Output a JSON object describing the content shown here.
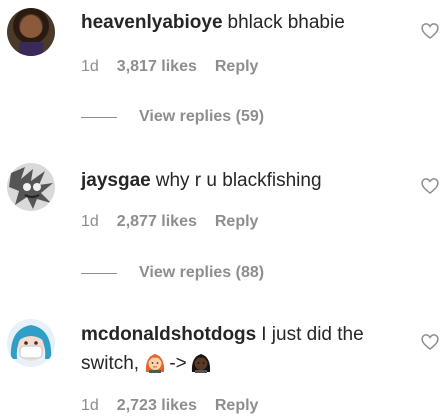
{
  "comments": [
    {
      "username": "heavenlyabioye",
      "text": "bhlack bhabie",
      "time": "1d",
      "likes": "3,817 likes",
      "reply_label": "Reply",
      "view_replies": "View replies (59)"
    },
    {
      "username": "jaysgae",
      "text": "why r u blackfishing",
      "time": "1d",
      "likes": "2,877 likes",
      "reply_label": "Reply",
      "view_replies": "View replies (88)"
    },
    {
      "username": "mcdonaldshotdogs",
      "text_line1": "I just did the",
      "text_line2_prefix": "switch,",
      "arrow": "->",
      "time": "1d",
      "likes": "2,723 likes",
      "reply_label": "Reply"
    }
  ],
  "icons": {
    "heart": "heart-outline-icon",
    "emoji_1": "red-haired-woman-emoji",
    "emoji_2": "dark-skin-woman-emoji"
  },
  "colors": {
    "text": "#262626",
    "meta": "#8e8e8e"
  }
}
